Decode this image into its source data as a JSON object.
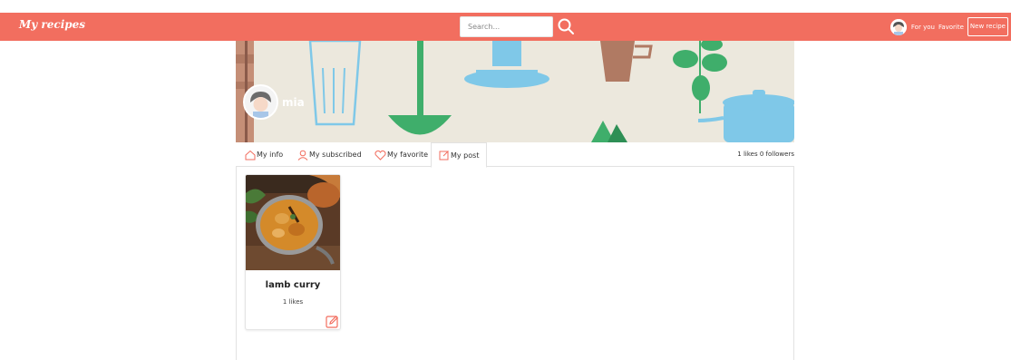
{
  "header": {
    "brand": "My recipes",
    "search_placeholder": "Search...",
    "for_you": "For you",
    "favorite": "Favorite",
    "new_recipe": "New recipe"
  },
  "profile": {
    "name": "mia"
  },
  "tabs": [
    {
      "label": "My info",
      "icon": "home-icon"
    },
    {
      "label": "My subscribed",
      "icon": "user-icon"
    },
    {
      "label": "My favorite",
      "icon": "heart-icon"
    },
    {
      "label": "My post",
      "icon": "edit-icon",
      "active": true
    }
  ],
  "stats": "1 likes  0 followers",
  "posts": [
    {
      "title": "lamb curry",
      "likes": "1 likes"
    }
  ],
  "colors": {
    "accent": "#f26e5f",
    "banner_bg": "#ece8dd"
  }
}
